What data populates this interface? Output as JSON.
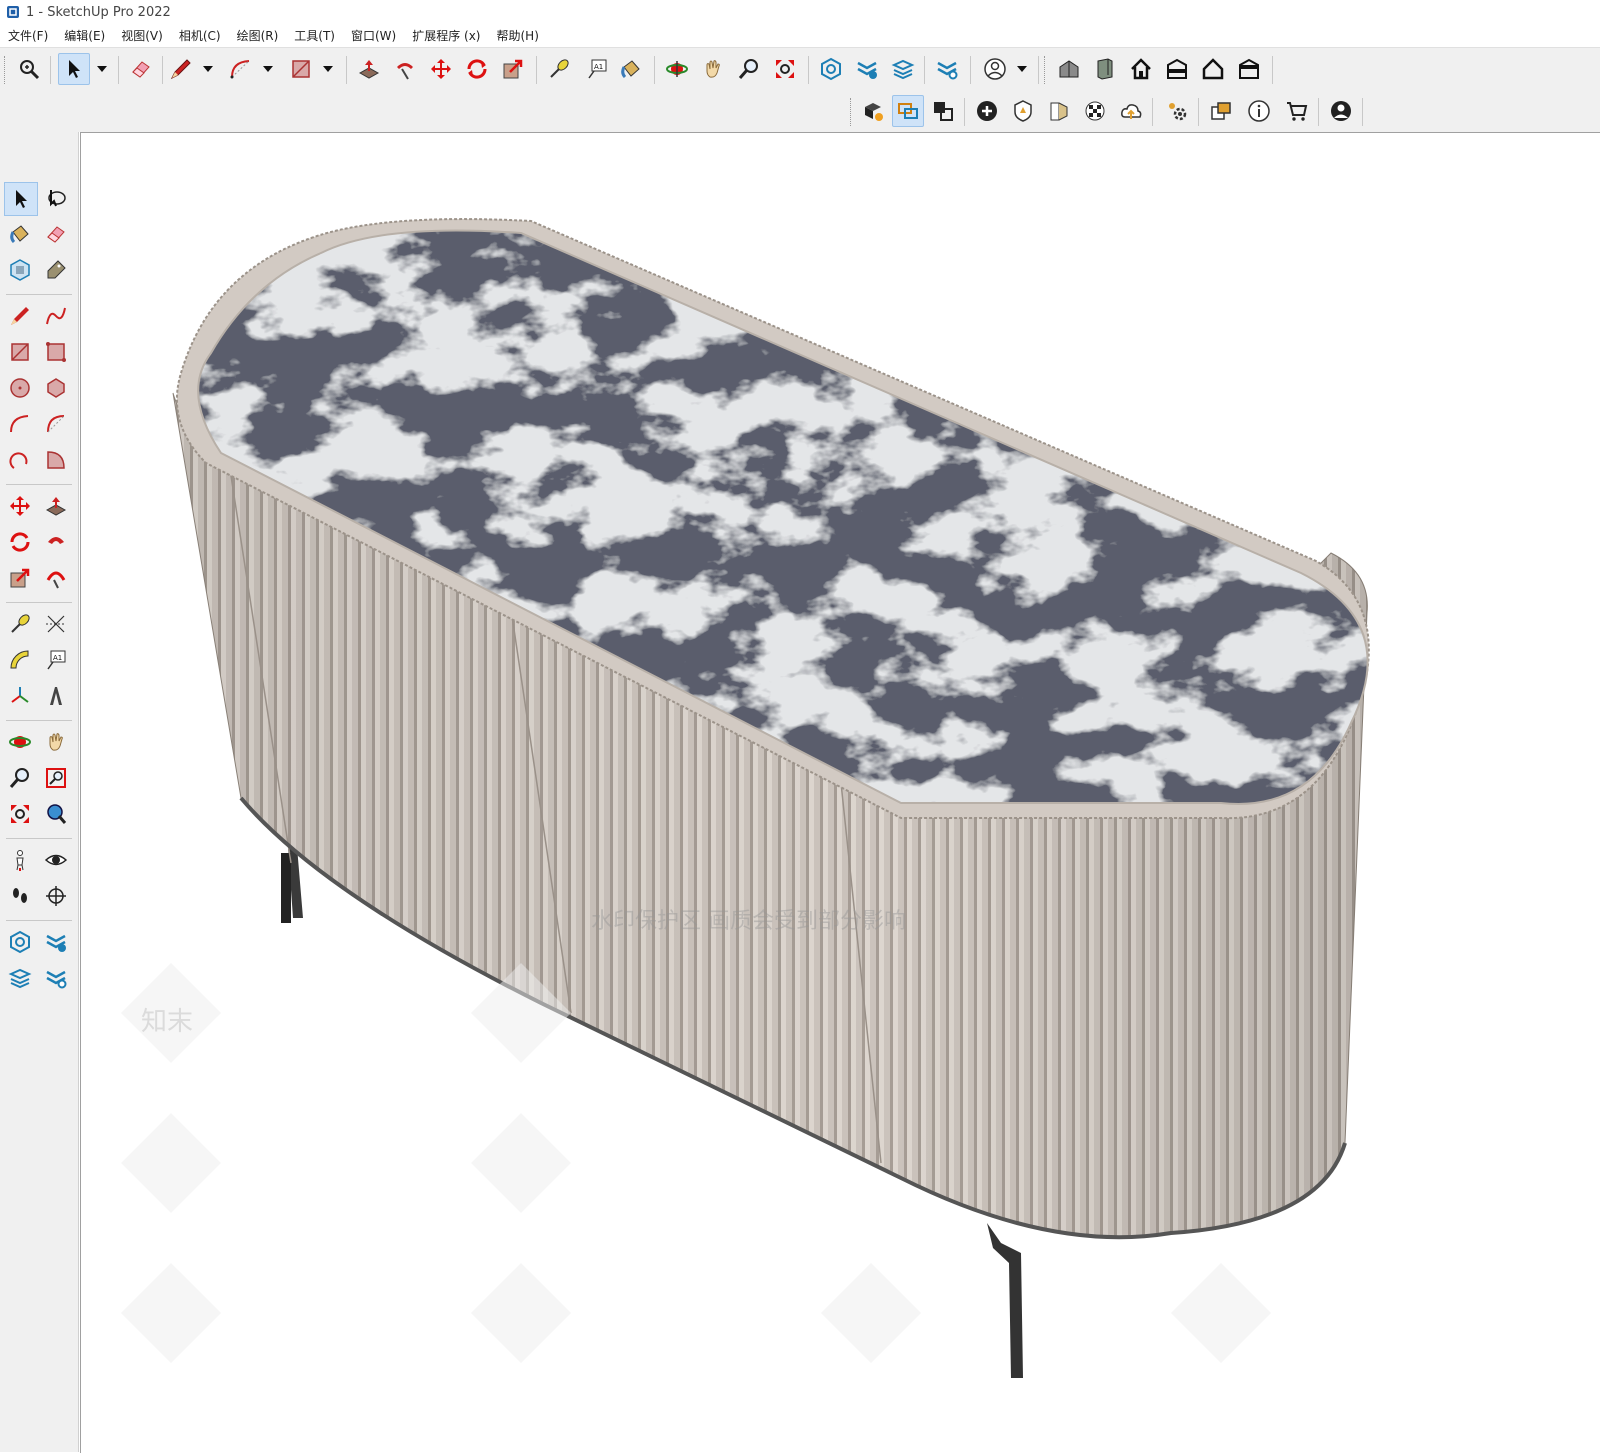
{
  "window": {
    "title": "1 - SketchUp Pro 2022"
  },
  "menu": [
    "文件(F)",
    "编辑(E)",
    "视图(V)",
    "相机(C)",
    "绘图(R)",
    "工具(T)",
    "窗口(W)",
    "扩展程序 (x)",
    "帮助(H)"
  ],
  "toolbar": {
    "text_tool_glyph": "A1"
  },
  "side_toolbar": {
    "text_tool_glyph": "A1"
  },
  "viewport": {
    "watermark_banner": "水印保护区  画质会受到部分影响",
    "watermark_logo": "知末"
  },
  "colors": {
    "ui_background": "#f0f0f0",
    "accent_selected": "#cfe3f8",
    "cabinet_body": "#cbc3bc",
    "marble_base": "#e4e6e8",
    "marble_vein": "#1a1d26",
    "legs": "#333333"
  }
}
